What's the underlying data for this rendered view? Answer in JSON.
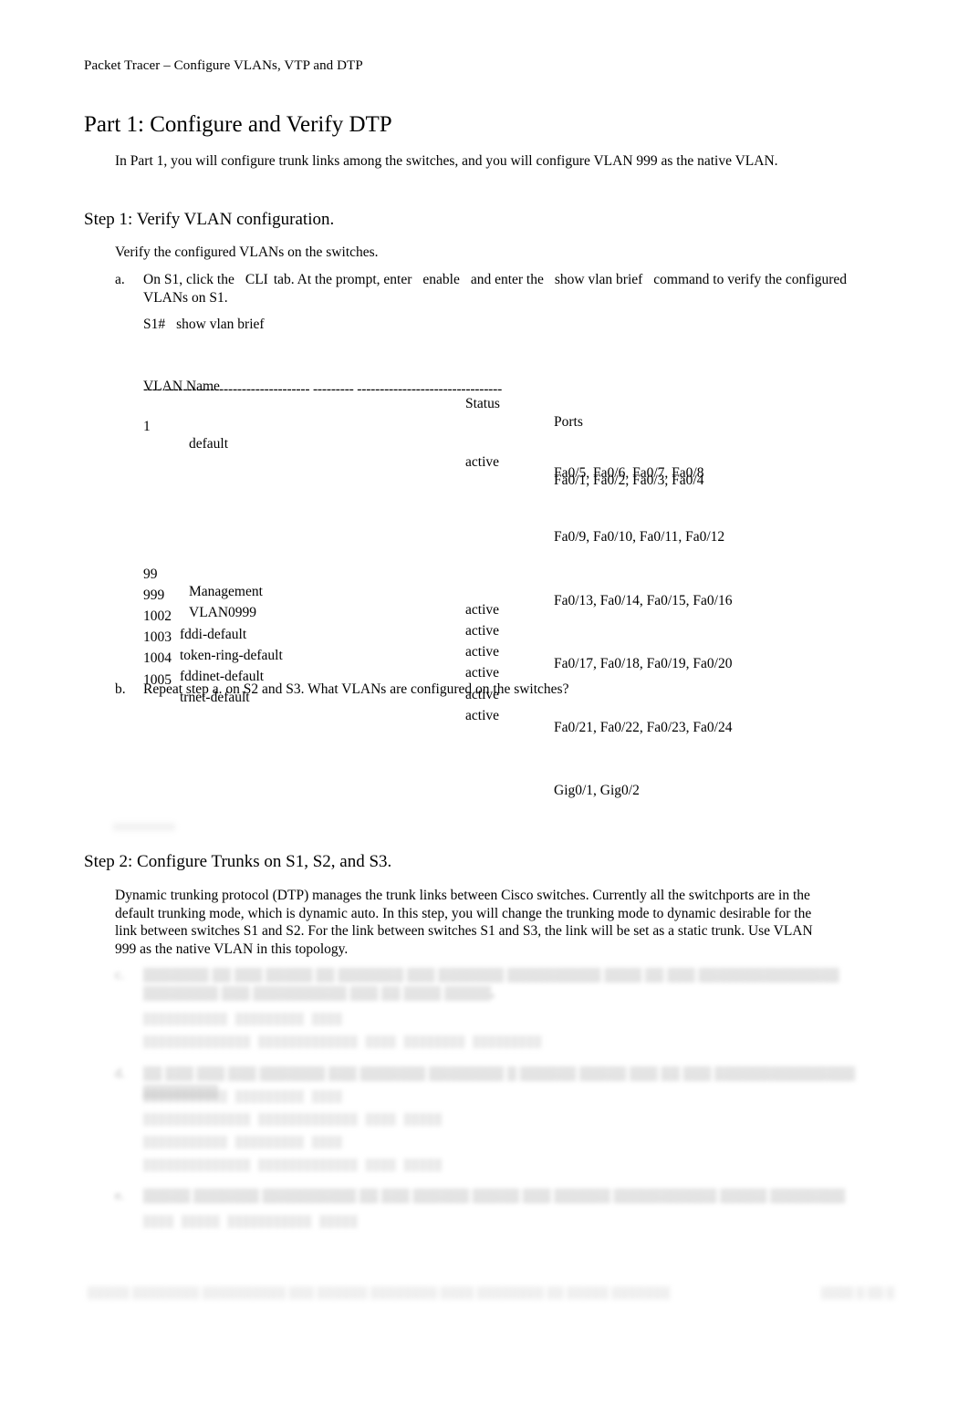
{
  "document": {
    "running_header": "Packet Tracer – Configure VLANs, VTP and DTP"
  },
  "part": {
    "heading": "Part 1: Configure and Verify DTP",
    "intro": "In Part 1, you will configure trunk links among the switches, and you will configure VLAN 999 as the native VLAN."
  },
  "step1": {
    "heading": "Step 1: Verify VLAN configuration.",
    "intro": "Verify the configured VLANs on the switches.",
    "item_a": {
      "marker": "a.",
      "text_1": "On S1, click the",
      "code_1": "CLI",
      "text_2": "tab. At the prompt, enter",
      "code_2": "enable",
      "text_3": "and enter the",
      "code_3": "show vlan brief",
      "text_4": "command to verify the configured VLANs on S1."
    },
    "cli_prompt": "S1#",
    "cli_command": "show vlan brief",
    "table": {
      "headers": {
        "vlan_name": "VLAN Name",
        "status": "Status",
        "ports": "Ports"
      },
      "separator": "---- -------------------------------- --------- --------------------------------",
      "rows": [
        {
          "id": "1",
          "name": "default",
          "status": "active",
          "ports": "Fa0/1, Fa0/2, Fa0/3, Fa0/4"
        },
        {
          "id": "99",
          "name": "Management",
          "status": "active",
          "ports": ""
        },
        {
          "id": "999",
          "name": "VLAN0999",
          "status": "active",
          "ports": ""
        },
        {
          "id": "1002",
          "name": "fddi-default",
          "status": "active",
          "ports": ""
        },
        {
          "id": "1003",
          "name": "token-ring-default",
          "status": "active",
          "ports": ""
        },
        {
          "id": "1004",
          "name": "fddinet-default",
          "status": "active",
          "ports": ""
        },
        {
          "id": "1005",
          "name": "trnet-default",
          "status": "active",
          "ports": ""
        }
      ],
      "ports_continued": [
        "Fa0/5, Fa0/6, Fa0/7, Fa0/8",
        "Fa0/9, Fa0/10, Fa0/11, Fa0/12",
        "Fa0/13, Fa0/14, Fa0/15, Fa0/16",
        "Fa0/17, Fa0/18, Fa0/19, Fa0/20",
        "Fa0/21, Fa0/22, Fa0/23, Fa0/24",
        "Gig0/1, Gig0/2"
      ]
    },
    "item_b": {
      "marker": "b.",
      "text": "Repeat step a. on S2 and S3. What VLANs are configured on the switches?"
    }
  },
  "step2": {
    "heading": "Step 2: Configure Trunks on S1, S2, and S3.",
    "intro": "Dynamic trunking protocol (DTP) manages the trunk links between Cisco switches. Currently all the switchports are in the default trunking mode, which is dynamic auto. In this step, you will change the trunking mode to dynamic desirable for the link between switches S1 and S2. For the link between switches S1 and S3, the link will be set as a static trunk. Use VLAN 999 as the native VLAN in this topology.",
    "obscured_items": [
      {
        "marker": "c.",
        "text": "▒▒▒▒▒▒▒ ▒▒ ▒▒▒ ▒▒▒▒▒ ▒▒ ▒▒▒▒▒▒▒ ▒▒▒ ▒▒▒▒▒▒▒ ▒▒▒▒▒▒▒▒▒▒ ▒▒▒▒ ▒▒ ▒▒▒ ▒▒▒▒▒▒▒▒▒▒▒▒▒▒▒ ▒▒▒▒▒▒▒▒ ▒▒▒ ▒▒▒▒▒▒▒▒▒▒ ▒▒▒ ▒▒ ▒▒▒▒ ▒▒▒▒▒.",
        "code_lines": [
          "▒▒▒▒▒▒▒▒▒▒▒ ▒▒▒▒▒▒▒▒▒ ▒▒▒▒",
          "▒▒▒▒▒▒▒▒▒▒▒▒▒▒ ▒▒▒▒▒▒▒▒▒▒▒▒▒ ▒▒▒▒ ▒▒▒▒▒▒▒▒ ▒▒▒▒▒▒▒▒▒"
        ]
      },
      {
        "marker": "d.",
        "text": "▒▒ ▒▒▒ ▒▒▒ ▒▒▒ ▒▒▒▒▒▒▒ ▒▒▒ ▒▒▒▒▒▒▒ ▒▒▒▒▒▒▒▒ ▒ ▒▒▒▒▒▒ ▒▒▒▒▒ ▒▒▒ ▒▒ ▒▒▒ ▒▒▒▒▒▒▒▒▒▒▒▒▒▒▒ ▒▒▒▒▒▒▒▒",
        "code_lines": [
          "▒▒▒▒▒▒▒▒▒▒▒ ▒▒▒▒▒▒▒▒▒ ▒▒▒▒",
          "▒▒▒▒▒▒▒▒▒▒▒▒▒▒ ▒▒▒▒▒▒▒▒▒▒▒▒▒ ▒▒▒▒ ▒▒▒▒▒",
          "▒▒▒▒▒▒▒▒▒▒▒ ▒▒▒▒▒▒▒▒▒ ▒▒▒▒",
          "▒▒▒▒▒▒▒▒▒▒▒▒▒▒ ▒▒▒▒▒▒▒▒▒▒▒▒▒ ▒▒▒▒ ▒▒▒▒▒"
        ]
      },
      {
        "marker": "e.",
        "text": "▒▒▒▒▒ ▒▒▒▒▒▒▒ ▒▒▒▒▒▒▒▒▒▒ ▒▒ ▒▒▒ ▒▒▒▒▒▒ ▒▒▒▒▒ ▒▒▒ ▒▒▒▒▒▒ ▒▒▒▒▒▒▒▒▒▒▒ ▒▒▒▒▒ ▒▒▒▒▒▒▒▒",
        "code_lines": [
          "▒▒▒▒ ▒▒▒▒▒ ▒▒▒▒▒▒▒▒▒▒▒ ▒▒▒▒▒"
        ]
      }
    ]
  },
  "footer": {
    "copyright": "▒▒▒▒▒ ▒▒▒▒▒▒▒▒ ▒▒▒▒▒▒▒▒▒▒ ▒▒▒ ▒▒▒▒▒▒ ▒▒▒▒▒▒▒▒ ▒▒▒▒ ▒▒▒▒▒▒▒▒ ▒▒ ▒▒▒▒▒ ▒▒▒▒▒▒▒",
    "page_number": "▒▒▒▒ ▒ ▒▒ ▒"
  }
}
